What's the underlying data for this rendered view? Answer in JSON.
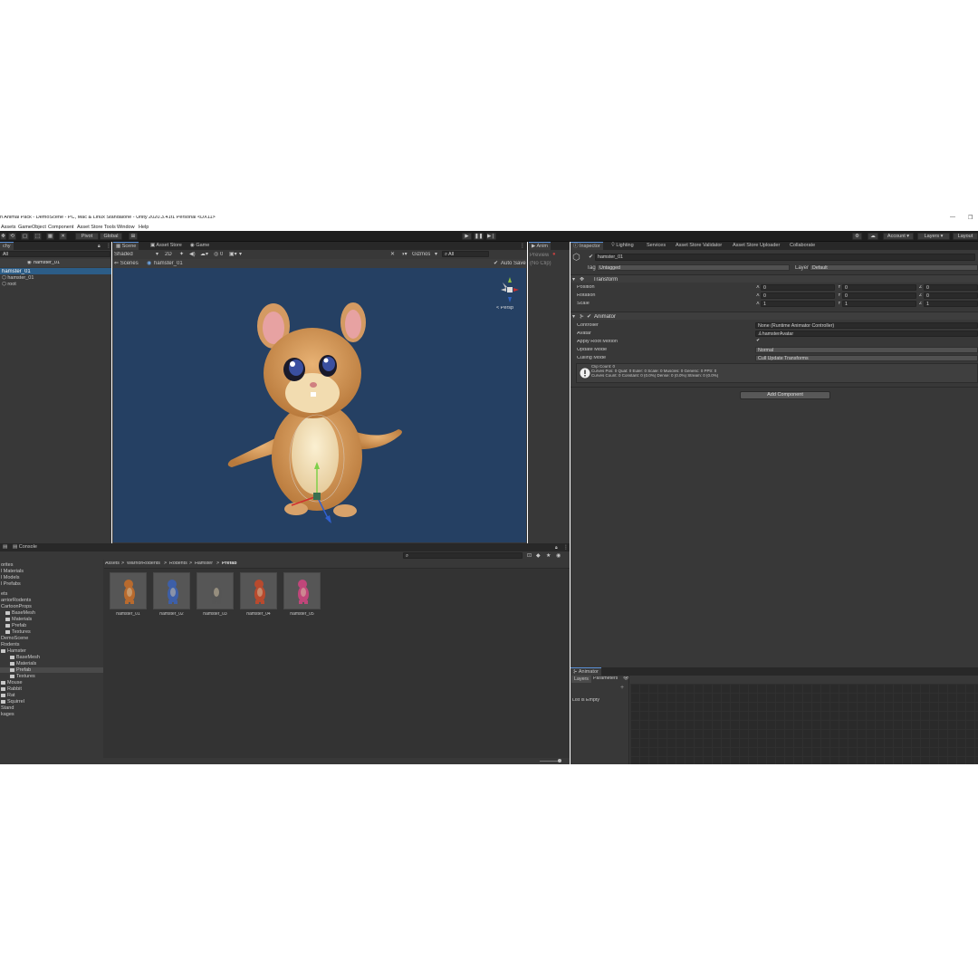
{
  "window": {
    "title": "n Animal Pack - DemoScene - PC, Mac & Linux Standalone - Unity 2020.3.41f1 Personal <DX11>",
    "minimize": "—",
    "restore": "❐"
  },
  "menu": [
    "Assets",
    "GameObject",
    "Component",
    "Asset Store Tools",
    "Window",
    "Help"
  ],
  "toolbar": {
    "pivot": "Pivot",
    "global": "Global",
    "account": "Account",
    "layers": "Layers",
    "layout": "Layout"
  },
  "hierarchy": {
    "tab": "chy",
    "search": "All",
    "scene_object": "hamster_01",
    "items": [
      "hamster_01",
      "hamster_01",
      "root"
    ]
  },
  "scene": {
    "tabs": [
      "Scene",
      "Asset Store",
      "Game"
    ],
    "shading": "Shaded",
    "mode_2d": "2D",
    "gizmos": "Gizmos",
    "search_placeholder": "All",
    "breadcrumb_root": "Scenes",
    "breadcrumb_object": "hamster_01",
    "auto_save": "Auto Save",
    "persp": "< Persp",
    "visibility_count": "0"
  },
  "anim_panel": {
    "tab": "Anim",
    "preview": "Preview",
    "clip": "(No Clip)"
  },
  "inspector": {
    "tabs": [
      "Inspector",
      "Lighting",
      "Services",
      "Asset Store Validator",
      "Asset Store Uploader",
      "Collaborate"
    ],
    "object_name": "hamster_01",
    "tag_label": "Tag",
    "tag_value": "Untagged",
    "layer_label": "Layer",
    "layer_value": "Default",
    "transform": {
      "header": "Transform",
      "rows": [
        {
          "label": "Position",
          "x": "0",
          "y": "0",
          "z": "0"
        },
        {
          "label": "Rotation",
          "x": "0",
          "y": "0",
          "z": "0"
        },
        {
          "label": "Scale",
          "x": "1",
          "y": "1",
          "z": "1"
        }
      ],
      "axis": [
        "X",
        "Y",
        "Z"
      ]
    },
    "animator": {
      "header": "Animator",
      "controller_label": "Controller",
      "controller_value": "None (Runtime Animator Controller)",
      "avatar_label": "Avatar",
      "avatar_value": "hamsterAvatar",
      "root_motion_label": "Apply Root Motion",
      "update_mode_label": "Update Mode",
      "update_mode_value": "Normal",
      "culling_mode_label": "Culling Mode",
      "culling_mode_value": "Cull Update Transforms",
      "info": [
        "Clip Count: 0",
        "Curves Pos: 0 Quat: 0 Euler: 0 Scale: 0 Muscles: 0 Generic: 0 PPtr: 0",
        "Curves Count: 0 Constant: 0 (0.0%) Dense: 0 (0.0%) Stream: 0 (0.0%)"
      ]
    },
    "add_component": "Add Component"
  },
  "project": {
    "tab": "Console",
    "breadcrumb": [
      "Assets",
      "WarriorRodents",
      "Rodents",
      "Hamster",
      "Prefab"
    ],
    "tree": [
      {
        "label": "orites",
        "indent": 0,
        "folder": false
      },
      {
        "label": "l Materials",
        "indent": 0,
        "folder": false
      },
      {
        "label": "l Models",
        "indent": 0,
        "folder": false
      },
      {
        "label": "l Prefabs",
        "indent": 0,
        "folder": false
      },
      {
        "label": "ets",
        "indent": 0,
        "folder": false,
        "gap": true
      },
      {
        "label": "arriorRodents",
        "indent": 0,
        "folder": false
      },
      {
        "label": "CartoonProps",
        "indent": 0,
        "folder": false
      },
      {
        "label": "BaseMesh",
        "indent": 1,
        "folder": true
      },
      {
        "label": "Materials",
        "indent": 1,
        "folder": true
      },
      {
        "label": "Prefab",
        "indent": 1,
        "folder": true
      },
      {
        "label": "Textures",
        "indent": 1,
        "folder": true
      },
      {
        "label": "DemoScene",
        "indent": 0,
        "folder": false
      },
      {
        "label": "Rodents",
        "indent": 0,
        "folder": false
      },
      {
        "label": "Hamster",
        "indent": 0,
        "folder": true
      },
      {
        "label": "BaseMesh",
        "indent": 2,
        "folder": true
      },
      {
        "label": "Materials",
        "indent": 2,
        "folder": true
      },
      {
        "label": "Prefab",
        "indent": 2,
        "folder": true,
        "selected": true
      },
      {
        "label": "Textures",
        "indent": 2,
        "folder": true
      },
      {
        "label": "Mouse",
        "indent": 0,
        "folder": true
      },
      {
        "label": "Rabbit",
        "indent": 0,
        "folder": true
      },
      {
        "label": "Rat",
        "indent": 0,
        "folder": true
      },
      {
        "label": "Squirrel",
        "indent": 0,
        "folder": true
      },
      {
        "label": "Stand",
        "indent": 0,
        "folder": false
      },
      {
        "label": "kages",
        "indent": 0,
        "folder": false
      }
    ],
    "assets": [
      {
        "name": "hamster_01",
        "color": "#b86a2e"
      },
      {
        "name": "hamster_02",
        "color": "#3d5fa8"
      },
      {
        "name": "hamster_03",
        "color": "#555555"
      },
      {
        "name": "hamster_04",
        "color": "#b84a2e"
      },
      {
        "name": "hamster_05",
        "color": "#c0467a"
      }
    ]
  },
  "animator_window": {
    "tab": "Animator",
    "layers_tab": "Layers",
    "parameters_tab": "Parameters",
    "empty": "List is Empty",
    "add": "+"
  },
  "colors": {
    "viewport": "#254063",
    "selection": "#2c5d87",
    "accent": "#5a8fd6"
  }
}
